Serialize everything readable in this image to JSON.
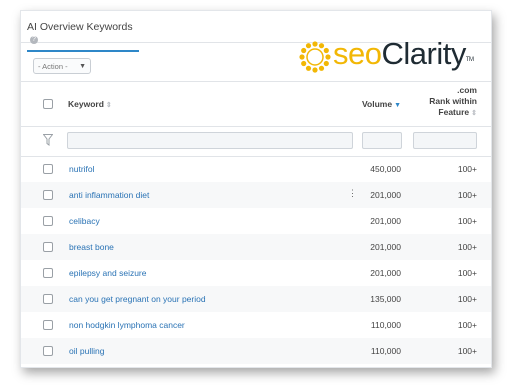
{
  "tab": {
    "label": "AI Overview Keywords"
  },
  "logo": {
    "seo": "seo",
    "clarity": "Clarity",
    "tm": "TM"
  },
  "action_select": {
    "value": "- Action -"
  },
  "table": {
    "headers": {
      "keyword": "Keyword",
      "volume": "Volume",
      "rank_line1": ".com",
      "rank_line2": "Rank within",
      "rank_line3": "Feature"
    },
    "rows": [
      {
        "keyword": "nutrifol",
        "volume": "450,000",
        "rank": "100+"
      },
      {
        "keyword": "anti inflammation diet",
        "volume": "201,000",
        "rank": "100+"
      },
      {
        "keyword": "celibacy",
        "volume": "201,000",
        "rank": "100+"
      },
      {
        "keyword": "breast bone",
        "volume": "201,000",
        "rank": "100+"
      },
      {
        "keyword": "epilepsy and seizure",
        "volume": "201,000",
        "rank": "100+"
      },
      {
        "keyword": "can you get pregnant on your period",
        "volume": "135,000",
        "rank": "100+"
      },
      {
        "keyword": "non hodgkin lymphoma cancer",
        "volume": "110,000",
        "rank": "100+"
      },
      {
        "keyword": "oil pulling",
        "volume": "110,000",
        "rank": "100+"
      }
    ]
  },
  "colors": {
    "accent": "#2e87c8",
    "link": "#2a73b5",
    "logo_yellow": "#f2b705",
    "logo_dark": "#1f2b33"
  }
}
